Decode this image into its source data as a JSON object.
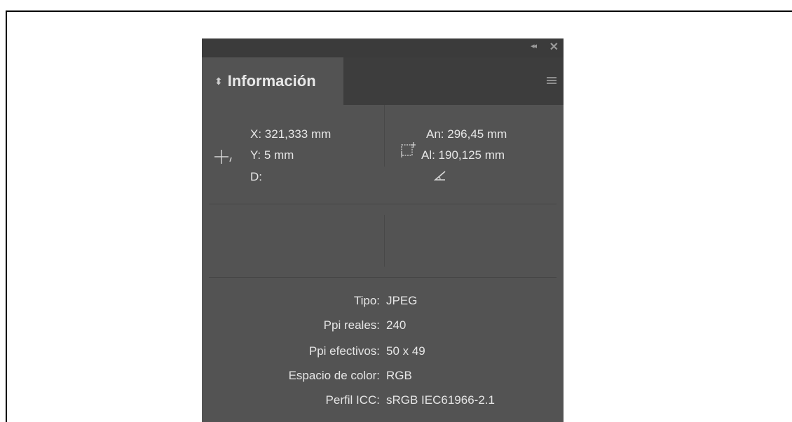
{
  "panel": {
    "tab_label": "Información",
    "tab_arrows": "⬍",
    "collapse_glyph": "◂◂",
    "close_glyph": "✕"
  },
  "position": {
    "x": "X: 321,333 mm",
    "y": "Y: 5 mm",
    "d": "D:"
  },
  "size": {
    "width": "An: 296,45 mm",
    "height": "Al: 190,125 mm"
  },
  "file_info": [
    {
      "key": "Tipo:",
      "value": "JPEG"
    },
    {
      "key": "Ppi reales:",
      "value": "240"
    },
    {
      "key": "Ppi efectivos:",
      "value": "50 x 49"
    },
    {
      "key": "Espacio de color:",
      "value": "RGB"
    },
    {
      "key": "Perfil ICC:",
      "value": "sRGB IEC61966-2.1"
    }
  ],
  "icons": [
    "crosshair-icon",
    "bounding-box-icon",
    "angle-icon",
    "panel-menu-icon",
    "collapse-icon",
    "close-icon"
  ]
}
